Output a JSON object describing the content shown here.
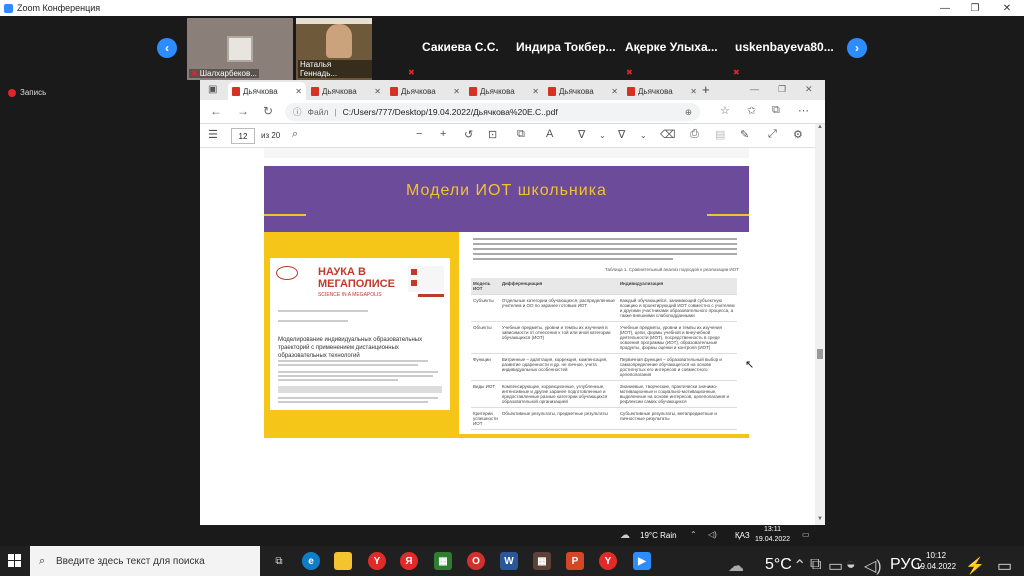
{
  "window": {
    "title": "Zoom Конференция",
    "minimize": "—",
    "maximize": "❐",
    "close": "✕"
  },
  "participants": {
    "video": [
      {
        "name": "Шалхарбеков..."
      },
      {
        "name": "Наталья Геннадь..."
      }
    ],
    "names": [
      "Сакиева С.С.",
      "Индира Токбер...",
      "Ақерке Улыха...",
      "uskenbayeva80..."
    ],
    "prev": "‹",
    "next": "›"
  },
  "recording": {
    "label": "Запись"
  },
  "browser": {
    "tabs": [
      {
        "label": "Дьячкова"
      },
      {
        "label": "Дьячкова"
      },
      {
        "label": "Дьячкова"
      },
      {
        "label": "Дьячкова"
      },
      {
        "label": "Дьячкова"
      },
      {
        "label": "Дьячкова"
      }
    ],
    "new_tab": "+",
    "address": {
      "scheme_label": "Файл",
      "url": "C:/Users/777/Desktop/19.04.2022/Дьячкова%20Е.С..pdf"
    },
    "pdf": {
      "page": "12",
      "of": "из 20"
    }
  },
  "slide": {
    "title": "Модели ИОТ школьника",
    "journal_title_1": "НАУКА В",
    "journal_title_2": "МЕГАПОЛИСЕ",
    "journal_sub": "SCIENCE IN A MEGAPOLIS",
    "article_title": "Моделирование индивидуальных образовательных траекторий с применением дистанционных образовательных технологий",
    "table_caption": "Таблица 1. Сравнительный анализ подходов к реализации ИОТ",
    "table": {
      "headers": [
        "Модель ИОТ",
        "Дифференциация",
        "Индивидуализация"
      ],
      "rows": [
        [
          "Субъекты",
          "Отдельные категории обучающихся, распределенные учителем и ОО по заранее готовым ИОТ",
          "Каждый обучающийся, занимающий субъектную позицию и проектирующий ИОТ совместно с учителем и другими участниками образовательного процесса, а также внешними слабоподданными"
        ],
        [
          "Объекты",
          "Учебные предметы, уровни и темпы их изучения в зависимости от отнесения к той или иной категории обучающихся (ИОТ)",
          "Учебные предметы, уровни и темпы их изучения (ИОТ), цели, формы учебной и внеучебной деятельности (ИОТ), посредственность в среде освоения программы (ИОТ), образовательные продукты, формы оценки и контроля (ИОТ)"
        ],
        [
          "Функции",
          "Витринные – адаптация, коррекция, компенсация, развитие одаренности и др. не личное, учета индивидуальных особенностей",
          "Первичная функция – образовательный выбор и самоопределение обучающегося на основе достигнутых его интересов и совместного целеполагания"
        ],
        [
          "Виды ИОТ",
          "Компенсирующие, коррекционные, углубленные, интенсивные и другие заранее подготовленные и предоставленные разные категории обучающихся образовательной организацией",
          "Знаниевые, творческие, практически значимо-мотивационные и социально-мотивационные, выделенные на основе интересов, целеполагания и рефлексии самих обучающихся"
        ],
        [
          "Критерии успешности ИОТ",
          "Объективные результаты, предметные результаты",
          "Субъективные результаты, метапредметные и личностные результаты"
        ]
      ]
    }
  },
  "chrome_status": {
    "weather": "19°C Rain",
    "lang": "ҚАЗ",
    "time": "13:11",
    "date": "19.04.2022"
  },
  "taskbar": {
    "search_placeholder": "Введите здесь текст для поиска",
    "apps": [
      "chrome",
      "edge",
      "mail",
      "zoom",
      "folder",
      "powerpoint",
      "file-explorer",
      "edge",
      "folder",
      "yandex",
      "yandex-browser",
      "calculator",
      "opera",
      "word",
      "app-grid",
      "powerpoint",
      "yandex",
      "zoom"
    ],
    "weather": "5°C",
    "lang": "РУС",
    "time": "10:12",
    "date": "19.04.2022",
    "colors": {
      "accent": "#2d8cff",
      "purple": "#6b4b9a",
      "yellow": "#f5c518",
      "title_yellow": "#f2c230"
    }
  }
}
